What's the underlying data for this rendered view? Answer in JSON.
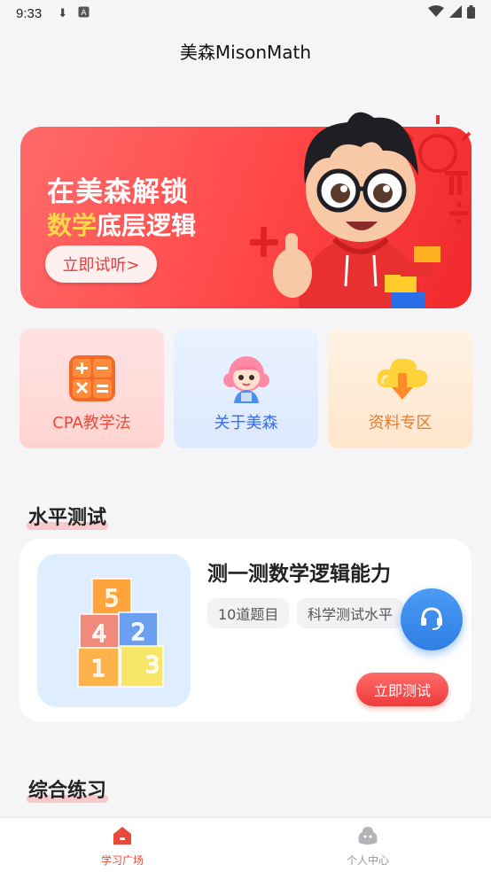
{
  "status_bar": {
    "time": "9:33"
  },
  "header": {
    "title": "美森MisonMath"
  },
  "banner": {
    "line1": "在美森解锁",
    "line2_highlight": "数学",
    "line2_rest": "底层逻辑",
    "button_label": "立即试听>"
  },
  "quick_tiles": [
    {
      "label": "CPA教学法"
    },
    {
      "label": "关于美森"
    },
    {
      "label": "资料专区"
    }
  ],
  "level_test": {
    "section_title": "水平测试",
    "card_title": "测一测数学逻辑能力",
    "chips": [
      "10道题目",
      "科学测试水平"
    ],
    "button_label": "立即测试"
  },
  "practice": {
    "section_title": "综合练习"
  },
  "tabbar": {
    "items": [
      {
        "label": "学习广场",
        "active": true
      },
      {
        "label": "个人中心",
        "active": false
      }
    ]
  },
  "colors": {
    "accent": "#e84a3a",
    "banner": "#ff4646",
    "fab": "#2f7ee3"
  },
  "icons": [
    "download-icon",
    "keyboard-a-icon",
    "wifi-icon",
    "signal-icon",
    "battery-icon",
    "calculator-icon",
    "girl-avatar-icon",
    "cloud-download-icon",
    "number-blocks-image",
    "headset-icon",
    "home-icon",
    "profile-icon"
  ]
}
